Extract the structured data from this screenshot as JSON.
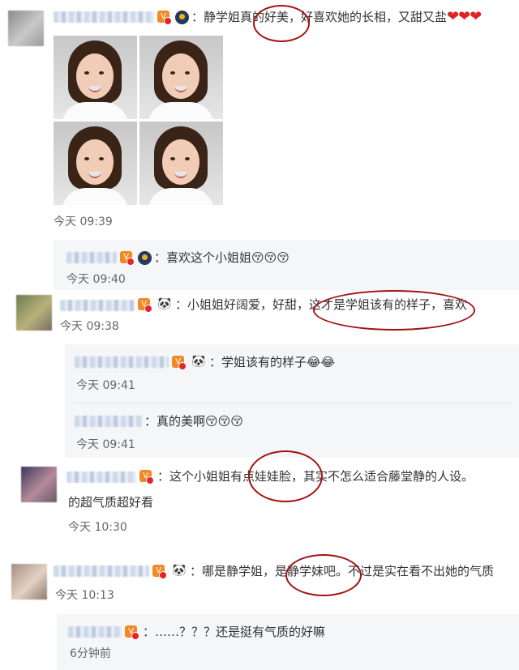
{
  "comments": [
    {
      "text": "：静学姐真的好美，好喜欢她的长相，又甜又盐",
      "hearts": "❤❤❤",
      "time": "今天 09:39"
    },
    {
      "text": "：小姐姐好阔爱，好甜，这才是学姐该有的样子，喜欢",
      "time": "今天 09:38"
    },
    {
      "text": "：这个小姐姐有点娃娃脸，其实不怎么适合藤堂静的人设。",
      "text_line2": "的超气质超好看",
      "time": "今天 10:30"
    },
    {
      "text": "：哪是静学姐，是静学妹吧。不过是实在看不出她的气质",
      "time": "今天 10:13"
    }
  ],
  "replies": [
    {
      "text": "：喜欢这个小姐姐",
      "emojis": "😚😚😚",
      "time": "今天 09:40"
    },
    {
      "text": "：学姐该有的样子",
      "emojis": "😂😂",
      "time": "今天 09:41"
    },
    {
      "text": "：真的美啊",
      "emojis": "😚😚😚",
      "time": "今天 09:41"
    },
    {
      "text": "：……？？？还是挺有气质的好嘛",
      "time": "6分钟前"
    }
  ]
}
